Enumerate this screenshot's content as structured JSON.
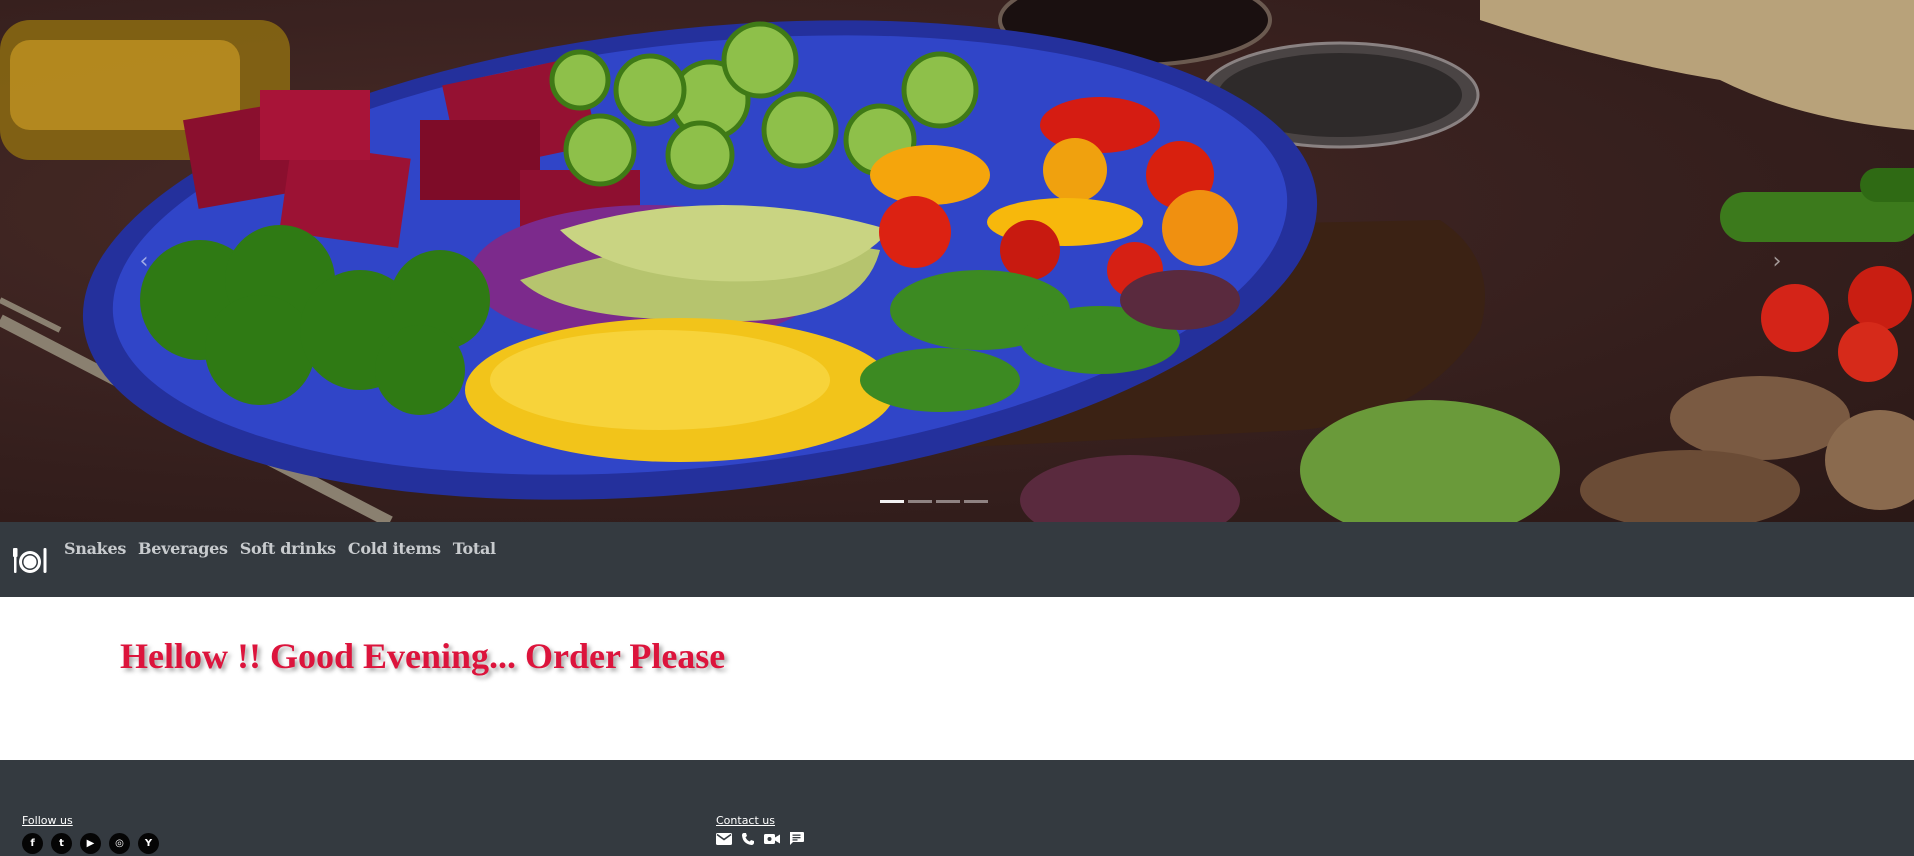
{
  "carousel": {
    "prev_icon": "chevron-left-icon",
    "next_icon": "chevron-right-icon",
    "prev_glyph": "‹",
    "next_glyph": "›",
    "slide_count": 4,
    "active_slide": 1
  },
  "navbar": {
    "brand_icon": "plate-cutlery-icon",
    "links": [
      "Snakes",
      "Beverages",
      "Soft drinks",
      "Cold items",
      "Total"
    ]
  },
  "main": {
    "greeting": "Hellow !! Good Evening... Order Please",
    "greeting_color": "#dc143c"
  },
  "footer": {
    "follow_us": "Follow us",
    "contact_us": "Contact us",
    "social_icons": [
      {
        "name": "facebook-icon",
        "glyph": "f"
      },
      {
        "name": "twitter-icon",
        "glyph": "t"
      },
      {
        "name": "youtube-icon",
        "glyph": "▶"
      },
      {
        "name": "instagram-icon",
        "glyph": "◎"
      },
      {
        "name": "yahoo-icon",
        "glyph": "Y"
      }
    ],
    "contact_icons": [
      "mail-icon",
      "phone-icon",
      "video-call-icon",
      "chat-icon"
    ]
  },
  "colors": {
    "navbar_bg": "#343a40",
    "footer_bg": "#343a40",
    "nav_link": "#c8cbce",
    "greeting": "#dc143c"
  }
}
